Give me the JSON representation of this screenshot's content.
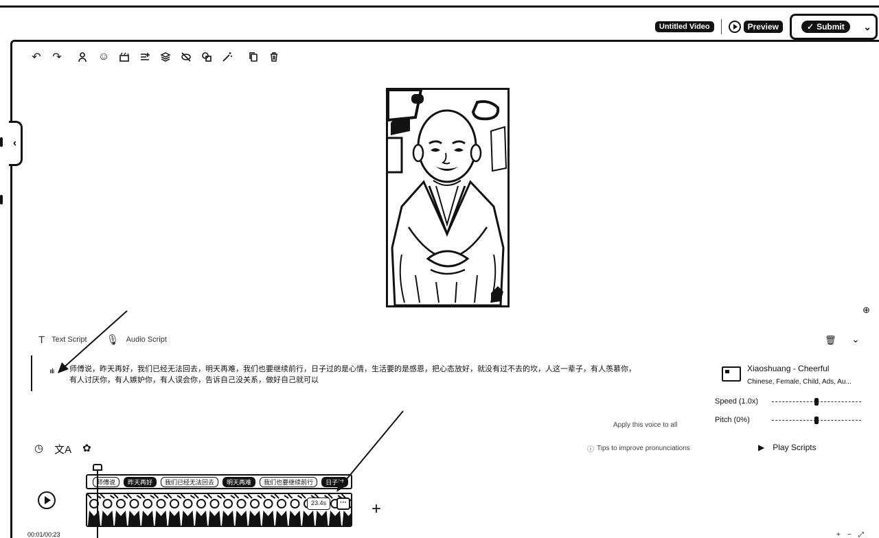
{
  "header": {
    "title": "Untitled Video",
    "preview_label": "Preview",
    "submit_label": "Submit"
  },
  "script": {
    "tab_text": "Text Script",
    "tab_audio": "Audio Script",
    "text_line1": "师傅说，昨天再好，我们已经无法回去，明天再难，我们也要继续前行，日子过的是心情，生活要的是感恩，把心态放好，就没有过不去的坎，人这一辈子，有人羡慕你，",
    "text_line2": "有人讨厌你，有人嫉妒你，有人误会你，告诉自己没关系，做好自己就可以"
  },
  "voice": {
    "name": "Xiaoshuang - Cheerful",
    "desc": "Chinese, Female, Child, Ads, Au...",
    "speed_label": "Speed (1.0x)",
    "pitch_label": "Pitch (0%)",
    "speed_level": 0.5,
    "pitch_level": 0.5,
    "apply_label": "Apply this voice to all",
    "tips_label": "Tips to improve pronunciations",
    "play_scripts_label": "Play Scripts"
  },
  "timeline": {
    "time": "00:01/00:23",
    "clip_duration": "23.4s",
    "more_label": "···",
    "add_label": "+",
    "captions": [
      "师傅说",
      "昨天再好",
      "我们已经无法回去",
      "明天再难",
      "我们也要继续前行",
      "日子过"
    ]
  }
}
